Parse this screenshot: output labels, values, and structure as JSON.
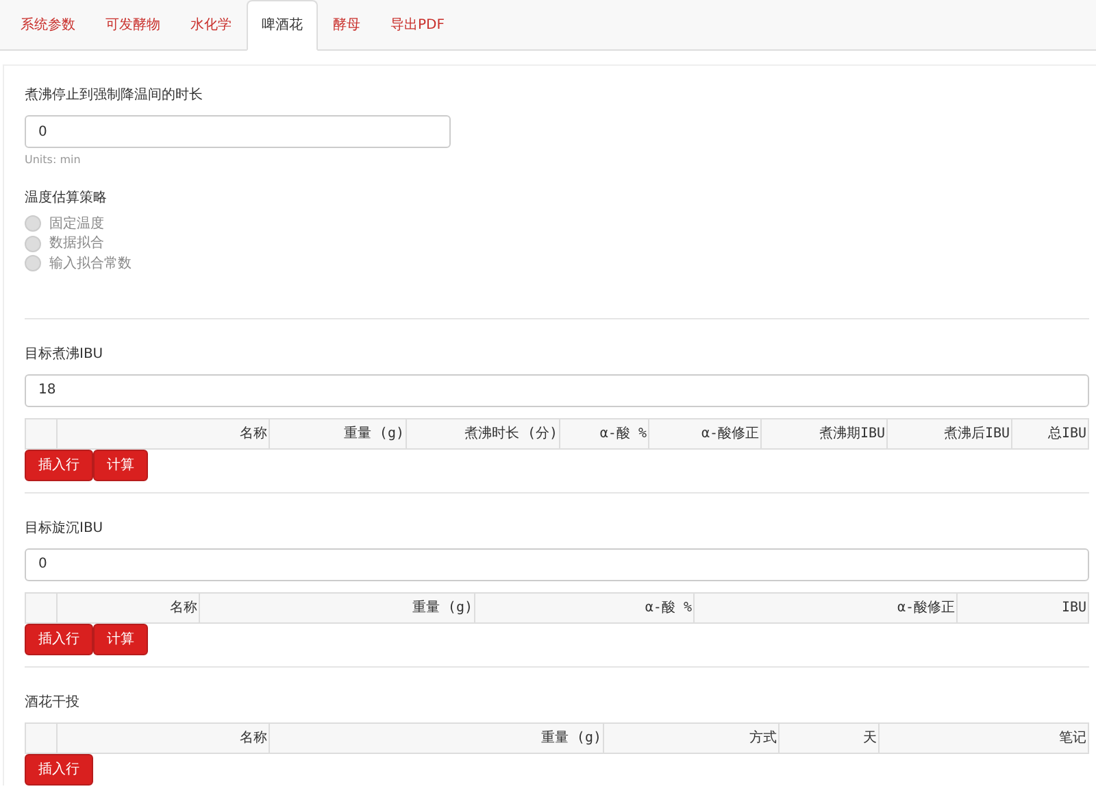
{
  "tabs": [
    {
      "label": "系统参数",
      "selected": false
    },
    {
      "label": "可发酵物",
      "selected": false
    },
    {
      "label": "水化学",
      "selected": false
    },
    {
      "label": "啤酒花",
      "selected": true
    },
    {
      "label": "酵母",
      "selected": false
    },
    {
      "label": "导出PDF",
      "selected": false
    }
  ],
  "cooling": {
    "label": "煮沸停止到强制降温间的时长",
    "value": "0",
    "help": "Units: min"
  },
  "strategy": {
    "label": "温度估算策略",
    "options": [
      {
        "label": "固定温度",
        "selected": false
      },
      {
        "label": "数据拟合",
        "selected": false
      },
      {
        "label": "输入拟合常数",
        "selected": false
      }
    ]
  },
  "sections": [
    {
      "label": "目标煮沸IBU",
      "value": "18",
      "columns": [
        "名称",
        "重量 (g)",
        "煮沸时长 (分)",
        "α-酸 %",
        "α-酸修正",
        "煮沸期IBU",
        "煮沸后IBU",
        "总IBU"
      ],
      "buttons": [
        "插入行",
        "计算"
      ]
    },
    {
      "label": "目标旋沉IBU",
      "value": "0",
      "columns": [
        "名称",
        "重量 (g)",
        "α-酸 %",
        "α-酸修正",
        "IBU"
      ],
      "buttons": [
        "插入行",
        "计算"
      ]
    },
    {
      "label": "酒花干投",
      "columns": [
        "名称",
        "重量 (g)",
        "方式",
        "天",
        "笔记"
      ],
      "buttons": [
        "插入行"
      ]
    }
  ]
}
